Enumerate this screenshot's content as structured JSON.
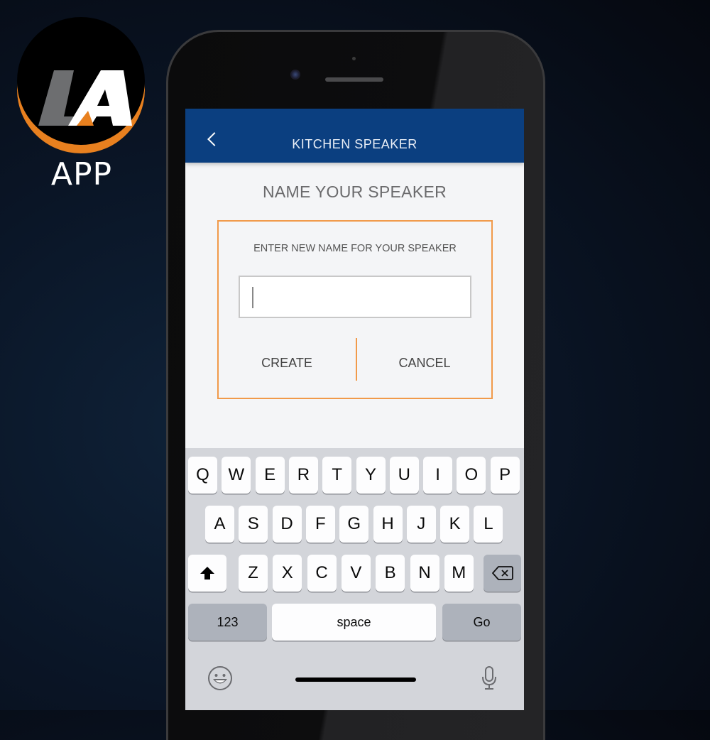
{
  "branding": {
    "logo_letters": "LA",
    "logo_caption": "APP",
    "colors": {
      "accent_orange": "#e8801f",
      "logo_gray": "#6d6e70",
      "logo_white": "#ffffff"
    }
  },
  "nav": {
    "back_icon": "chevron-left-icon",
    "title": "KITCHEN SPEAKER",
    "background": "#0b3f80"
  },
  "page": {
    "heading": "NAME YOUR SPEAKER"
  },
  "dialog": {
    "prompt": "ENTER NEW NAME FOR YOUR SPEAKER",
    "input_value": "",
    "input_placeholder": "",
    "create_label": "CREATE",
    "cancel_label": "CANCEL",
    "border_color": "#f19a4a"
  },
  "keyboard": {
    "row1": [
      "Q",
      "W",
      "E",
      "R",
      "T",
      "Y",
      "U",
      "I",
      "O",
      "P"
    ],
    "row2": [
      "A",
      "S",
      "D",
      "F",
      "G",
      "H",
      "J",
      "K",
      "L"
    ],
    "row3": [
      "Z",
      "X",
      "C",
      "V",
      "B",
      "N",
      "M"
    ],
    "shift_icon": "shift-arrow-icon",
    "backspace_icon": "backspace-icon",
    "numbers_label": "123",
    "space_label": "space",
    "return_label": "Go",
    "emoji_icon": "emoji-icon",
    "mic_icon": "microphone-icon"
  }
}
